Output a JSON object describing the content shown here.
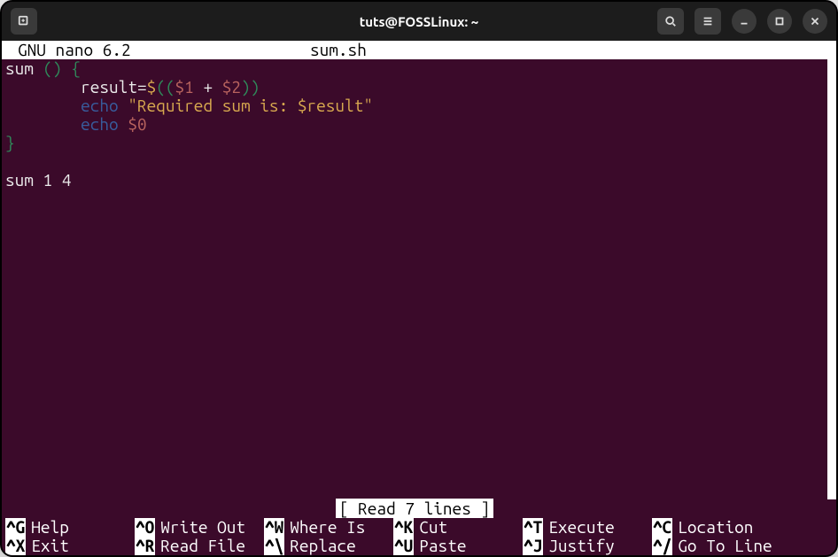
{
  "window": {
    "title": "tuts@FOSSLinux: ~"
  },
  "nano": {
    "app_name": "GNU nano 6.2",
    "filename": "sum.sh",
    "status": "[ Read 7 lines ]"
  },
  "code": {
    "line1_sum": "sum",
    "line1_rest": " () {",
    "line2_indent": "        ",
    "line2_result": "result",
    "line2_eq": "=",
    "line2_dollar": "$",
    "line2_dparen_o": "((",
    "line2_arg1": "$1",
    "line2_plus": " + ",
    "line2_arg2": "$2",
    "line2_dparen_c": "))",
    "line3_indent": "        ",
    "line3_echo": "echo",
    "line3_space": " ",
    "line3_string": "\"Required sum is: $result\"",
    "line4_indent": "        ",
    "line4_echo": "echo",
    "line4_space": " ",
    "line4_arg0": "$0",
    "line5_brace": "}",
    "line7": "sum 1 4"
  },
  "shortcuts": {
    "row1": [
      {
        "key": "^G",
        "label": "Help"
      },
      {
        "key": "^O",
        "label": "Write Out"
      },
      {
        "key": "^W",
        "label": "Where Is"
      },
      {
        "key": "^K",
        "label": "Cut"
      },
      {
        "key": "^T",
        "label": "Execute"
      },
      {
        "key": "^C",
        "label": "Location"
      }
    ],
    "row2": [
      {
        "key": "^X",
        "label": "Exit"
      },
      {
        "key": "^R",
        "label": "Read File"
      },
      {
        "key": "^\\",
        "label": "Replace"
      },
      {
        "key": "^U",
        "label": "Paste"
      },
      {
        "key": "^J",
        "label": "Justify"
      },
      {
        "key": "^/",
        "label": "Go To Line"
      }
    ]
  }
}
